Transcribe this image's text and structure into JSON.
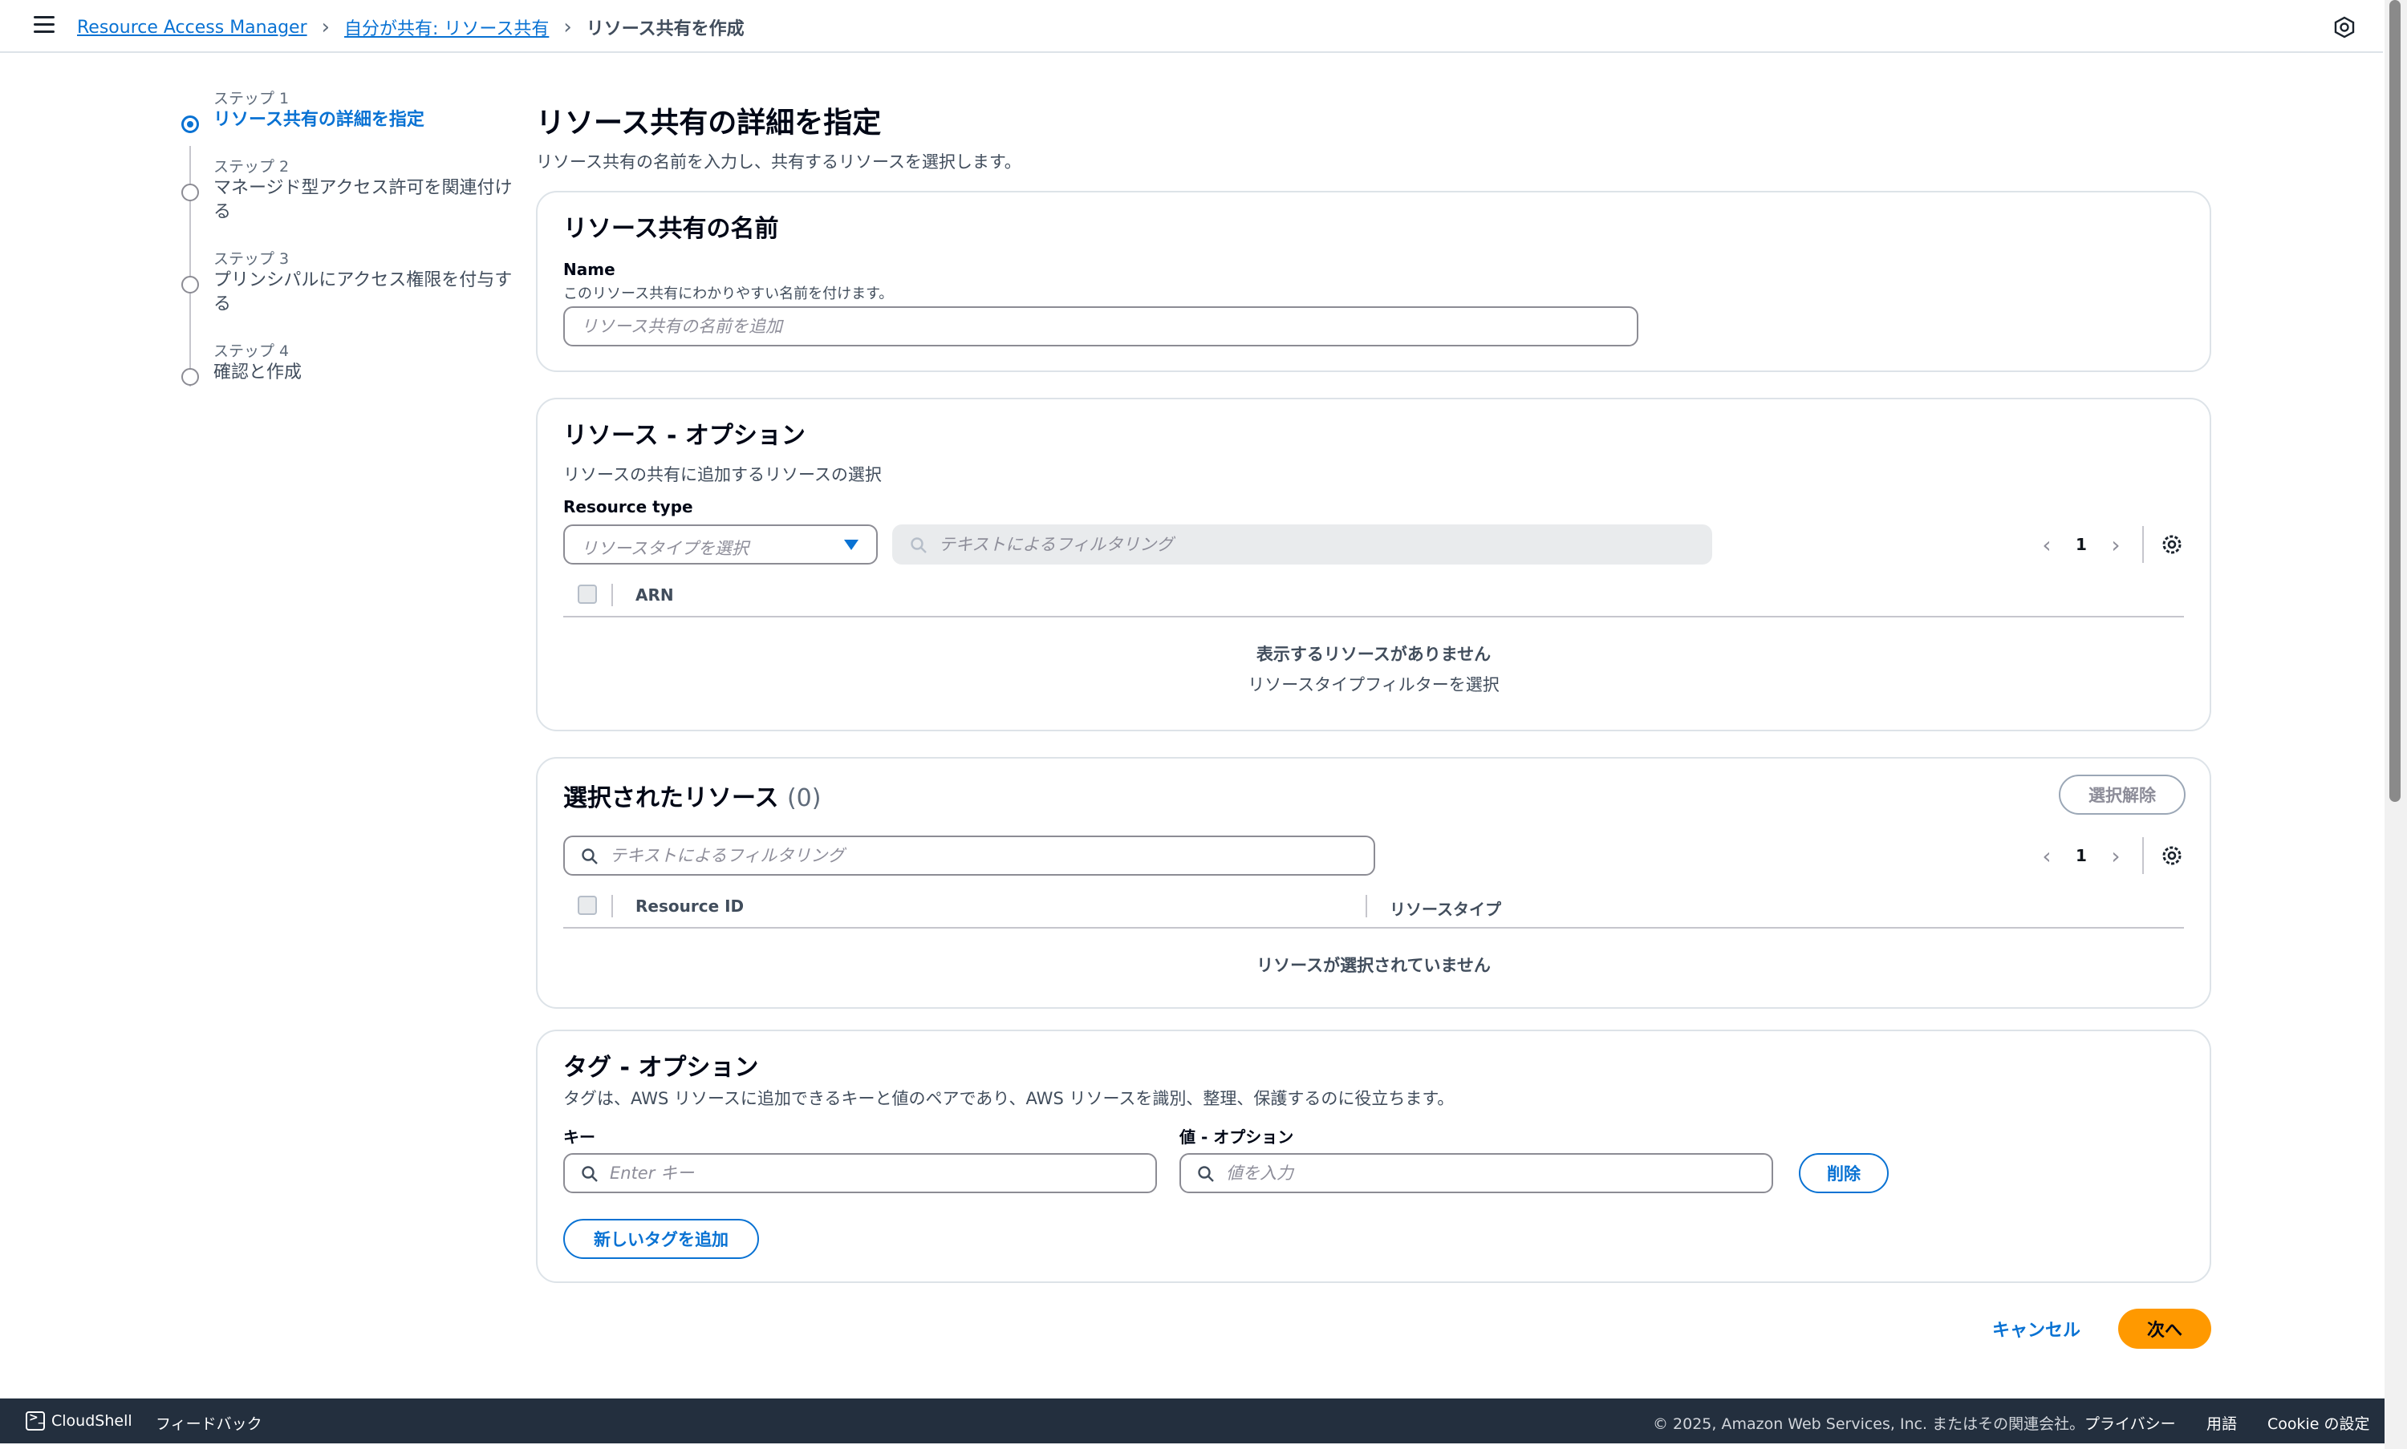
{
  "breadcrumb": {
    "items": [
      "Resource Access Manager",
      "自分が共有: リソース共有"
    ],
    "current": "リソース共有を作成"
  },
  "steps": [
    {
      "num": "ステップ 1",
      "title": "リソース共有の詳細を指定",
      "active": true
    },
    {
      "num": "ステップ 2",
      "title": "マネージド型アクセス許可を関連付ける",
      "active": false
    },
    {
      "num": "ステップ 3",
      "title": "プリンシパルにアクセス権限を付与する",
      "active": false
    },
    {
      "num": "ステップ 4",
      "title": "確認と作成",
      "active": false
    }
  ],
  "page": {
    "title": "リソース共有の詳細を指定",
    "description": "リソース共有の名前を入力し、共有するリソースを選択します。"
  },
  "name_card": {
    "header": "リソース共有の名前",
    "label": "Name",
    "sublabel": "このリソース共有にわかりやすい名前を付けます。",
    "placeholder": "リソース共有の名前を追加",
    "value": ""
  },
  "resources_card": {
    "header": "リソース - オプション",
    "description": "リソースの共有に追加するリソースの選択",
    "type_label": "Resource type",
    "type_placeholder": "リソースタイプを選択",
    "filter_placeholder": "テキストによるフィルタリング",
    "page": "1",
    "column": "ARN",
    "empty_title": "表示するリソースがありません",
    "empty_hint": "リソースタイプフィルターを選択"
  },
  "selected_card": {
    "header": "選択されたリソース",
    "count": "(0)",
    "deselect_label": "選択解除",
    "filter_placeholder": "テキストによるフィルタリング",
    "page": "1",
    "columns": [
      "Resource ID",
      "リソースタイプ"
    ],
    "empty": "リソースが選択されていません"
  },
  "tags_card": {
    "header": "タグ - オプション",
    "description": "タグは、AWS リソースに追加できるキーと値のペアであり、AWS リソースを識別、整理、保護するのに役立ちます。",
    "key_label": "キー",
    "value_label": "値 - オプション",
    "key_placeholder": "Enter キー",
    "value_placeholder": "値を入力",
    "remove_label": "削除",
    "add_label": "新しいタグを追加"
  },
  "actions": {
    "cancel": "キャンセル",
    "next": "次へ"
  },
  "footer": {
    "cloudshell": "CloudShell",
    "feedback": "フィードバック",
    "copyright": "© 2025, Amazon Web Services, Inc. またはその関連会社。",
    "privacy": "プライバシー",
    "terms": "用語",
    "cookies": "Cookie の設定"
  },
  "colors": {
    "link": "#0972d3",
    "primary": "#ff9900",
    "footer_bg": "#232f3e"
  }
}
